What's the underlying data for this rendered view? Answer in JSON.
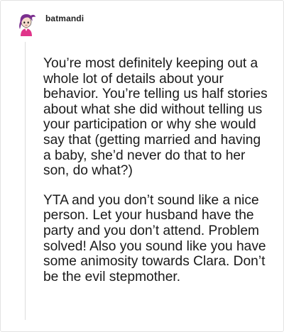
{
  "post": {
    "username": "batmandi",
    "avatar_icon": "purple-haired-cartoon-avatar-icon",
    "paragraphs": [
      "You’re most definitely keeping out a whole lot of details about your behavior. You’re telling us half stories about what she did without telling us your participation or why she would say that (getting married and having a baby, she’d never do that to her son, do what?)",
      "YTA and you don’t sound like a nice person. Let your husband have the party and you don’t attend. Problem solved! Also you sound like you have some animosity towards Clara. Don’t be the evil stepmother."
    ]
  },
  "colors": {
    "avatar_hair": "#7b2f8f",
    "avatar_shirt": "#e0348a",
    "text": "#1a1a1a",
    "border": "#e3e3e3"
  }
}
